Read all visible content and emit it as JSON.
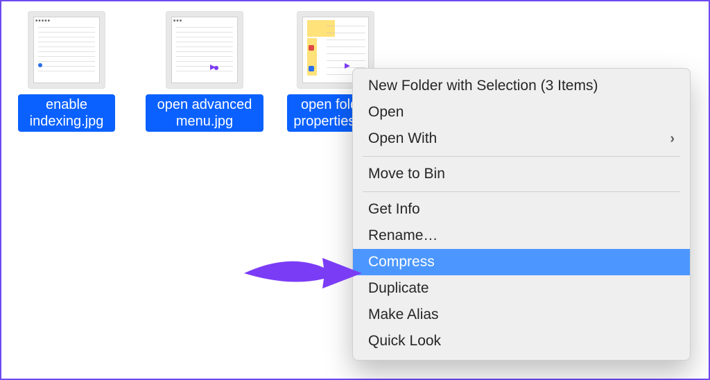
{
  "files": [
    {
      "name": "enable indexing.jpg"
    },
    {
      "name": "open advanced menu.jpg"
    },
    {
      "name": "open folder properties.jpg"
    }
  ],
  "context_menu": {
    "items": [
      {
        "label": "New Folder with Selection (3 Items)",
        "submenu": false
      },
      {
        "label": "Open",
        "submenu": false
      },
      {
        "label": "Open With",
        "submenu": true
      }
    ],
    "bin": {
      "label": "Move to Bin"
    },
    "group2": [
      {
        "label": "Get Info"
      },
      {
        "label": "Rename…"
      },
      {
        "label": "Compress",
        "highlighted": true
      },
      {
        "label": "Duplicate"
      },
      {
        "label": "Make Alias"
      },
      {
        "label": "Quick Look"
      }
    ]
  },
  "colors": {
    "selection": "#0a61ff",
    "menu_highlight": "#4c97ff",
    "arrow": "#7b3cf5"
  }
}
